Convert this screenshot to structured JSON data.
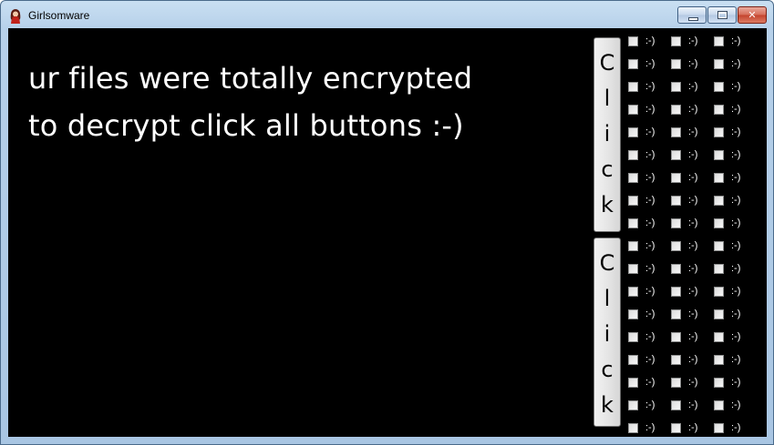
{
  "window": {
    "title": "Girlsomware",
    "controls": {
      "minimize_icon": "minimize-icon",
      "maximize_icon": "maximize-icon",
      "close_icon": "close-icon",
      "close_glyph": "✕"
    }
  },
  "message": {
    "line1": "ur files were totally encrypted",
    "line2": "to decrypt click all buttons :-)"
  },
  "buttons": [
    {
      "letters": [
        "C",
        "l",
        "i",
        "c",
        "k"
      ]
    },
    {
      "letters": [
        "C",
        "l",
        "i",
        "c",
        "k"
      ]
    }
  ],
  "checkboxes": {
    "label": ":-)",
    "columns": 3,
    "rows": 18,
    "checked": false
  }
}
